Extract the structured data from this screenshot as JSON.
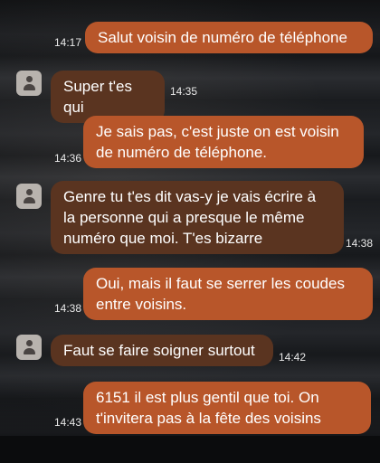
{
  "messages": [
    {
      "direction": "sent",
      "time": "14:17",
      "lines": [
        "Salut voisin de numéro de téléphone"
      ]
    },
    {
      "direction": "received",
      "time": "14:35",
      "lines": [
        "Super t'es qui"
      ]
    },
    {
      "direction": "sent",
      "time": "14:36",
      "lines": [
        "Je sais pas, c'est juste on est voisin",
        "de numéro de téléphone."
      ]
    },
    {
      "direction": "received",
      "time": "14:38",
      "lines": [
        "Genre tu t'es dit vas-y je vais écrire à",
        "la personne qui a presque le même",
        "numéro que moi. T'es bizarre"
      ]
    },
    {
      "direction": "sent",
      "time": "14:38",
      "lines": [
        "Oui, mais il faut se serrer les coudes",
        "entre voisins."
      ]
    },
    {
      "direction": "received",
      "time": "14:42",
      "lines": [
        "Faut se faire soigner surtout"
      ]
    },
    {
      "direction": "sent",
      "time": "14:43",
      "lines": [
        "6151 il est plus gentil que toi. On",
        "t'invitera pas à la fête des voisins"
      ]
    }
  ],
  "colors": {
    "sent_bubble": "#b8562a",
    "received_bubble": "#5a3420",
    "text": "#ffffff"
  },
  "icons": {
    "avatar": "person-avatar-icon"
  }
}
